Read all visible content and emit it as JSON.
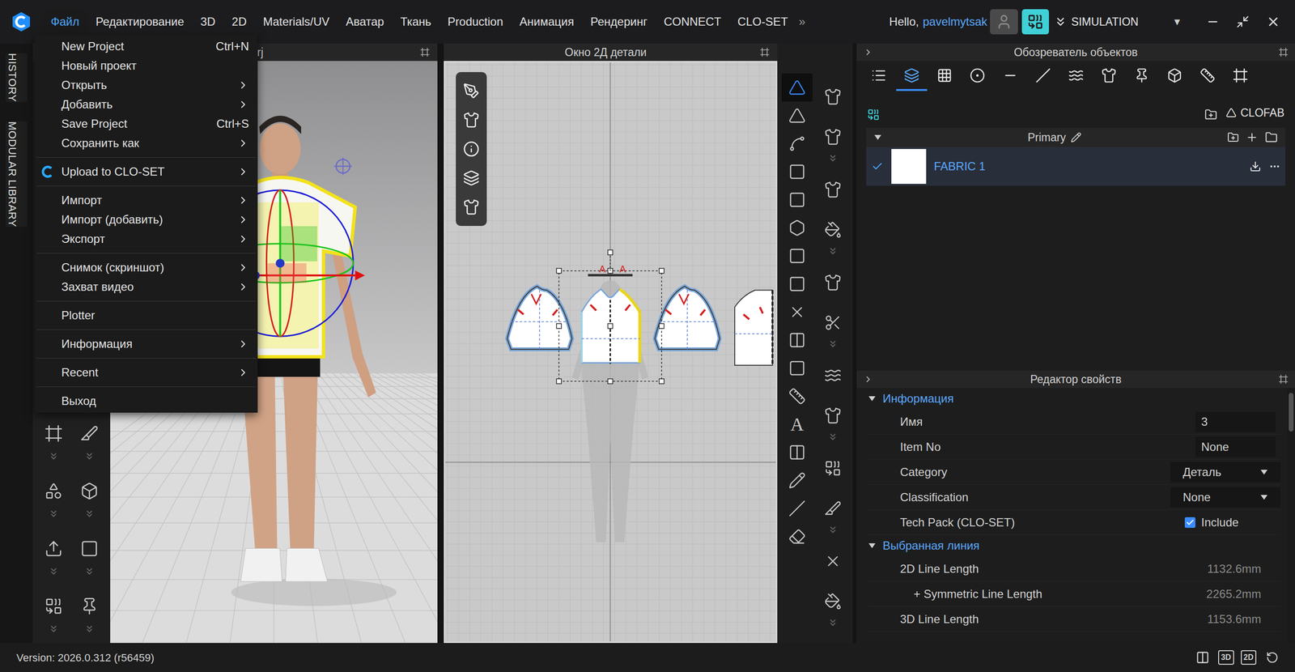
{
  "menubar": {
    "items": [
      {
        "label": "Файл",
        "selected": true
      },
      {
        "label": "Редактирование",
        "selected": false
      },
      {
        "label": "3D",
        "selected": false
      },
      {
        "label": "2D",
        "selected": false
      },
      {
        "label": "Materials/UV",
        "selected": false
      },
      {
        "label": "Аватар",
        "selected": false
      },
      {
        "label": "Ткань",
        "selected": false
      },
      {
        "label": "Production",
        "selected": false
      },
      {
        "label": "Анимация",
        "selected": false
      },
      {
        "label": "Рендеринг",
        "selected": false
      },
      {
        "label": "CONNECT",
        "selected": false
      },
      {
        "label": "CLO-SET",
        "selected": false
      }
    ],
    "overflow": "»",
    "greeting": "Hello,",
    "username": "pavelmytsak",
    "mode": "SIMULATION",
    "mode_dropdown": "▼"
  },
  "side_tabs": [
    "HISTORY",
    "MODULAR LIBRARY"
  ],
  "file_menu": [
    {
      "kind": "item",
      "label": "New Project",
      "shortcut": "Ctrl+N",
      "submenu": false
    },
    {
      "kind": "item",
      "label": "Новый проект",
      "shortcut": "",
      "submenu": false
    },
    {
      "kind": "item",
      "label": "Открыть",
      "shortcut": "",
      "submenu": true
    },
    {
      "kind": "item",
      "label": "Добавить",
      "shortcut": "",
      "submenu": true
    },
    {
      "kind": "item",
      "label": "Save Project",
      "shortcut": "Ctrl+S",
      "submenu": false
    },
    {
      "kind": "item",
      "label": "Сохранить как",
      "shortcut": "",
      "submenu": true
    },
    {
      "kind": "separator"
    },
    {
      "kind": "upload",
      "label": "Upload to CLO-SET",
      "shortcut": "",
      "submenu": true
    },
    {
      "kind": "separator"
    },
    {
      "kind": "item",
      "label": "Импорт",
      "shortcut": "",
      "submenu": true
    },
    {
      "kind": "item",
      "label": "Импорт (добавить)",
      "shortcut": "",
      "submenu": true
    },
    {
      "kind": "item",
      "label": "Экспорт",
      "shortcut": "",
      "submenu": true
    },
    {
      "kind": "separator"
    },
    {
      "kind": "item",
      "label": "Снимок (скриншот)",
      "shortcut": "",
      "submenu": true
    },
    {
      "kind": "item",
      "label": "Захват видео",
      "shortcut": "",
      "submenu": true
    },
    {
      "kind": "separator"
    },
    {
      "kind": "item",
      "label": "Plotter",
      "shortcut": "",
      "submenu": false
    },
    {
      "kind": "separator"
    },
    {
      "kind": "item",
      "label": "Информация",
      "shortcut": "",
      "submenu": true
    },
    {
      "kind": "separator"
    },
    {
      "kind": "item",
      "label": "Recent",
      "shortcut": "",
      "submenu": true
    },
    {
      "kind": "separator"
    },
    {
      "kind": "item",
      "label": "Выход",
      "shortcut": "",
      "submenu": false
    }
  ],
  "window_3d": {
    "title": "rj"
  },
  "window_2d": {
    "title": "Окно 2Д детали",
    "seam_markers": [
      "A",
      "A"
    ]
  },
  "tools_2d": [
    {
      "selected": true
    },
    {
      "selected": false
    },
    {
      "selected": false
    },
    {
      "selected": false
    },
    {
      "selected": false
    },
    {
      "selected": false
    },
    {
      "selected": false
    },
    {
      "selected": false
    },
    {
      "selected": false
    },
    {
      "selected": false
    },
    {
      "selected": false
    },
    {
      "selected": false
    },
    {
      "selected": false
    },
    {
      "selected": false
    },
    {
      "selected": false
    },
    {
      "selected": false
    },
    {
      "selected": false
    }
  ],
  "text_tool_glyph": "A",
  "object_browser": {
    "title": "Обозреватель объектов",
    "tabs": [
      {
        "selected": false
      },
      {
        "selected": true
      },
      {
        "selected": false
      },
      {
        "selected": false
      },
      {
        "selected": false
      },
      {
        "selected": false
      },
      {
        "selected": false
      },
      {
        "selected": false
      },
      {
        "selected": false
      },
      {
        "selected": false
      },
      {
        "selected": false
      },
      {
        "selected": false
      }
    ],
    "clofab": "CLOFAB",
    "group": "Primary",
    "fabrics": [
      {
        "name": "FABRIC 1",
        "checked": true,
        "selected": true
      }
    ]
  },
  "property_editor": {
    "title": "Редактор свойств",
    "sections": [
      {
        "title": "Информация",
        "expanded": true,
        "rows": [
          {
            "kind": "field",
            "label": "Имя",
            "value": "3"
          },
          {
            "kind": "field",
            "label": "Item No",
            "value": "None"
          },
          {
            "kind": "dropdown",
            "label": "Category",
            "value": "Деталь"
          },
          {
            "kind": "dropdown",
            "label": "Classification",
            "value": "None"
          },
          {
            "kind": "checkbox",
            "label": "Tech Pack (CLO-SET)",
            "value": "Include",
            "checked": true
          }
        ]
      },
      {
        "title": "Выбранная линия",
        "expanded": true,
        "rows": [
          {
            "kind": "reading",
            "label": "2D Line Length",
            "value": "1132.6mm"
          },
          {
            "kind": "subreading",
            "label": "+ Symmetric Line Length",
            "value": "2265.2mm"
          },
          {
            "kind": "reading",
            "label": "3D Line Length",
            "value": "1153.6mm"
          }
        ]
      }
    ]
  },
  "status_bar": {
    "version": "Version: 2026.0.312 (r56459)",
    "view_buttons": [
      "3D",
      "2D"
    ]
  }
}
